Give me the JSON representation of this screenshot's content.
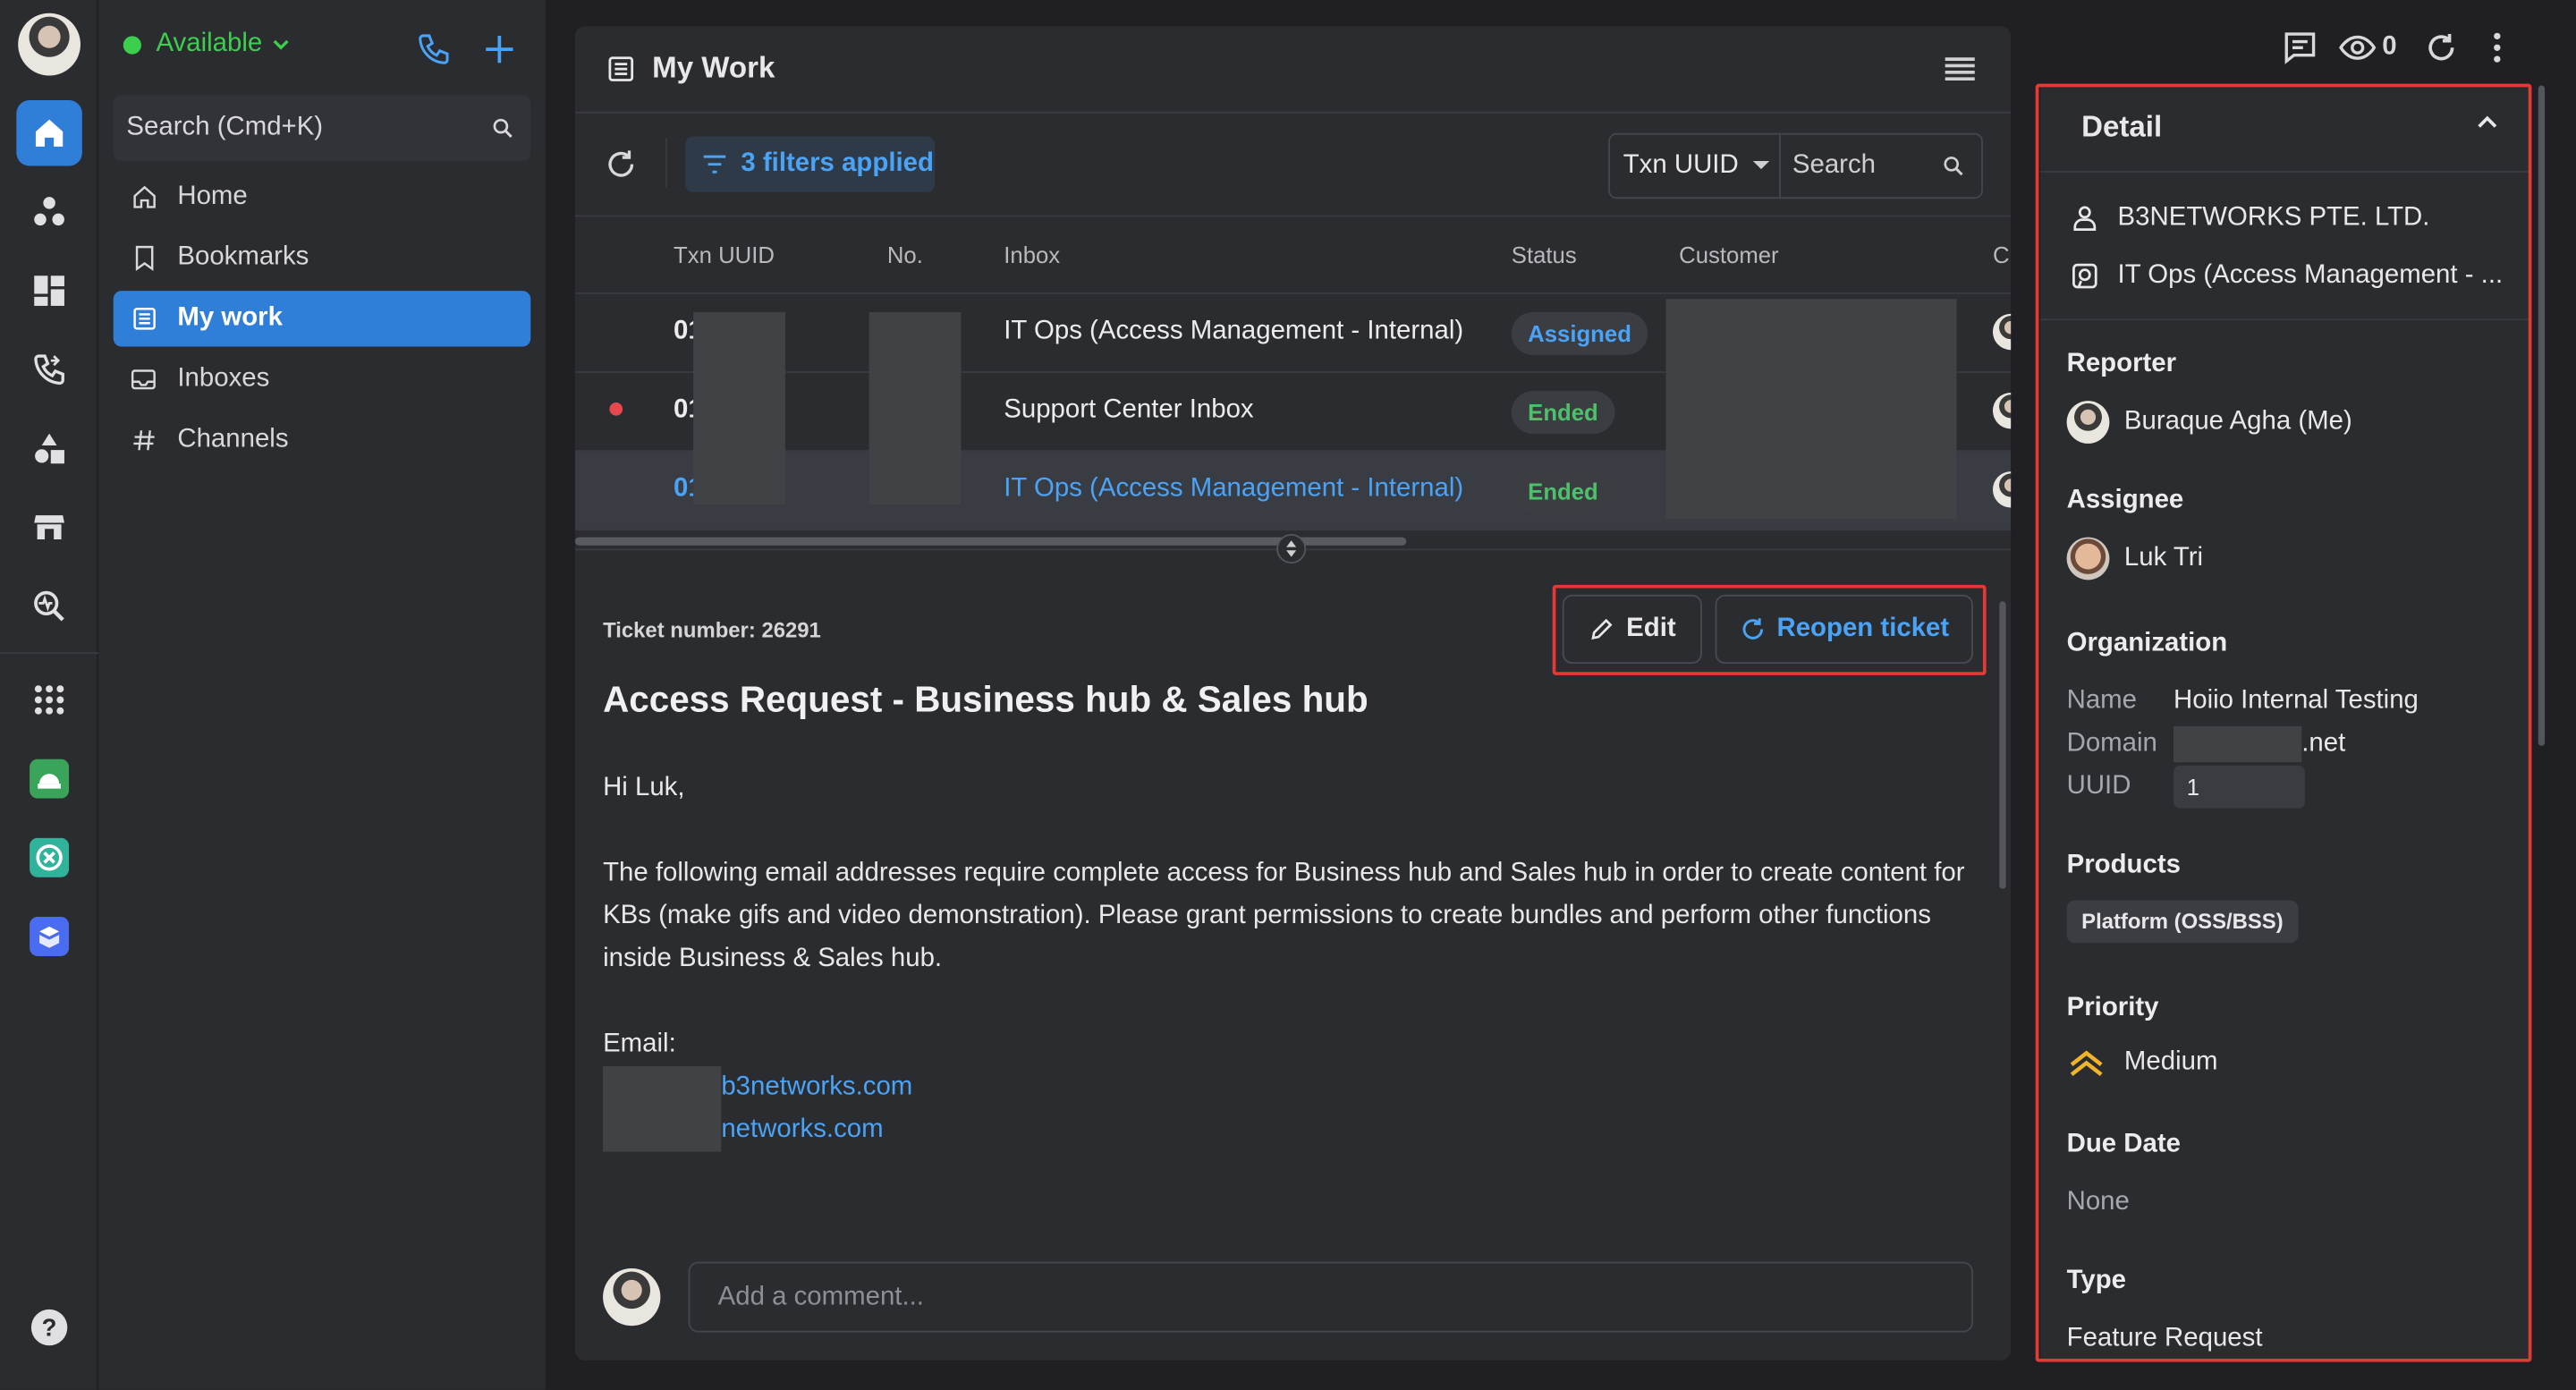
{
  "status": {
    "label": "Available",
    "color": "#3ccf4e"
  },
  "sidebar": {
    "search_placeholder": "Search (Cmd+K)",
    "items": [
      {
        "label": "Home",
        "icon": "home-icon"
      },
      {
        "label": "Bookmarks",
        "icon": "bookmark-icon"
      },
      {
        "label": "My work",
        "icon": "list-icon"
      },
      {
        "label": "Inboxes",
        "icon": "inbox-icon"
      },
      {
        "label": "Channels",
        "icon": "hash-icon"
      }
    ]
  },
  "main": {
    "title": "My Work",
    "filters_label": "3 filters applied",
    "search_field_select": "Txn UUID",
    "search_placeholder": "Search",
    "columns": [
      "Txn UUID",
      "No.",
      "Inbox",
      "Status",
      "Customer",
      "C"
    ],
    "rows": [
      {
        "txn": "01",
        "inbox": "IT Ops (Access Management - Internal)",
        "status": "Assigned",
        "unread": false,
        "selected": false
      },
      {
        "txn": "01",
        "inbox": "Support Center Inbox",
        "status": "Ended",
        "unread": true,
        "selected": false
      },
      {
        "txn": "01",
        "inbox": "IT Ops (Access Management - Internal)",
        "status": "Ended",
        "unread": false,
        "selected": true
      }
    ]
  },
  "ticket": {
    "number_label": "Ticket number: 26291",
    "edit_label": "Edit",
    "reopen_label": "Reopen ticket",
    "title": "Access Request - Business hub & Sales hub",
    "greeting": "Hi Luk,",
    "paragraph": "The following email addresses require complete access for Business hub and Sales hub in order to create content for KBs (make gifs and video demonstration). Please grant permissions to create bundles and perform other functions inside Business & Sales hub.",
    "email_label": "Email:",
    "emails": [
      "b3networks.com",
      "networks.com"
    ],
    "comment_placeholder": "Add a comment..."
  },
  "topbar": {
    "watch_count": "0"
  },
  "detail": {
    "title": "Detail",
    "company": "B3NETWORKS PTE. LTD.",
    "inbox": "IT Ops (Access Management - ...",
    "reporter_label": "Reporter",
    "reporter": "Buraque Agha (Me)",
    "assignee_label": "Assignee",
    "assignee": "Luk Tri",
    "organization_label": "Organization",
    "org_name_label": "Name",
    "org_name": "Hoiio Internal Testing",
    "org_domain_label": "Domain",
    "org_domain": ".net",
    "org_uuid_label": "UUID",
    "org_uuid": "1",
    "products_label": "Products",
    "product": "Platform (OSS/BSS)",
    "priority_label": "Priority",
    "priority": "Medium",
    "due_label": "Due Date",
    "due": "None",
    "type_label": "Type",
    "type": "Feature Request"
  },
  "colors": {
    "accent": "#2f7ed8",
    "link": "#4aa3f5",
    "highlight": "#e53935",
    "assigned": "#4aa3f5",
    "ended": "#4cc16a",
    "priority": "#f0b429"
  }
}
